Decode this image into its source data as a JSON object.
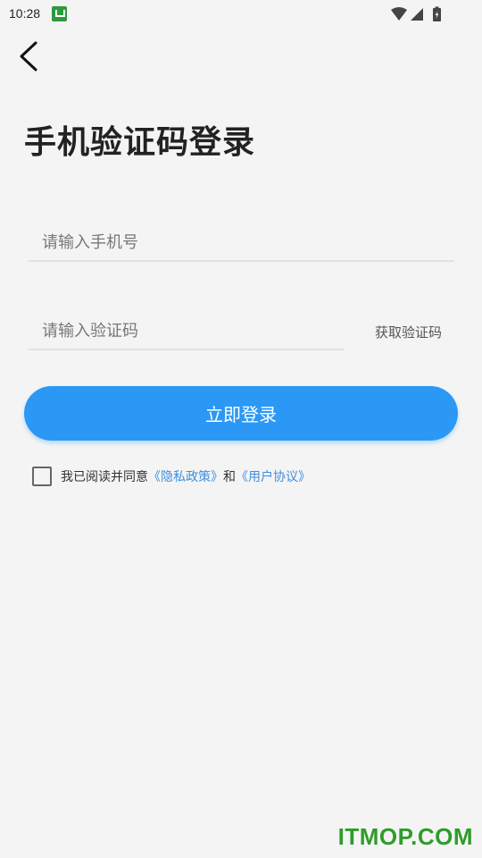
{
  "status_bar": {
    "time": "10:28",
    "icons": [
      "wifi-icon",
      "signal-icon",
      "battery-charging-icon"
    ]
  },
  "header": {
    "back_icon": "chevron-left-icon",
    "title": "手机验证码登录"
  },
  "form": {
    "phone_placeholder": "请输入手机号",
    "code_placeholder": "请输入验证码",
    "get_code_label": "获取验证码",
    "login_label": "立即登录"
  },
  "agreement": {
    "checked": false,
    "prefix": "我已阅读并同意",
    "privacy_link": "《隐私政策》",
    "and": "和",
    "user_link": "《用户协议》"
  },
  "watermark": "ITMOP.COM",
  "colors": {
    "accent": "#2b98f6",
    "link": "#3d8fe0",
    "background": "#f4f4f4"
  }
}
